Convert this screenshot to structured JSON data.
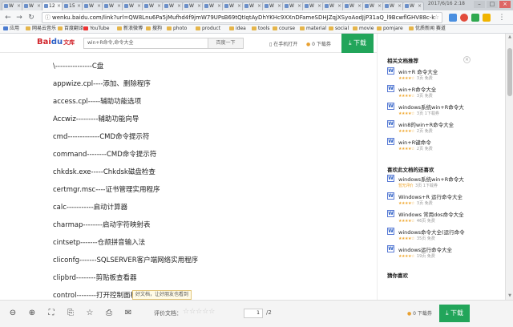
{
  "browser": {
    "tabs": [
      "W",
      "W",
      "12",
      "15",
      "W",
      "W",
      "W",
      "W",
      "W",
      "W",
      "W",
      "W",
      "W",
      "W",
      "W",
      "W",
      "W",
      "W",
      "W",
      "W",
      "W"
    ],
    "clock": "2017/6/16 2:18",
    "address": "wenku.baidu.com/link?url=QW8Lnu6Pa5jMufhd4f9jmW79UPsB69tQtIqtAyDhYKHc9XXnDFameSDHJZqjXSyoAodJjP31aQ_l9BcwflGHV88c-k",
    "bookmarks": [
      {
        "label": "应用",
        "icon": "apps-icon"
      },
      {
        "label": "网易云音乐",
        "icon": "folder-icon"
      },
      {
        "label": "百度翻译",
        "icon": "folder-icon"
      },
      {
        "label": "YouTube",
        "icon": "youtube-icon"
      },
      {
        "label": "新浪微博",
        "icon": "folder-icon"
      },
      {
        "label": "搜狗",
        "icon": "folder-icon"
      },
      {
        "label": "photo",
        "icon": "folder-icon"
      },
      {
        "label": "product",
        "icon": "folder-icon"
      },
      {
        "label": "idea",
        "icon": "folder-icon"
      },
      {
        "label": "tools",
        "icon": "folder-icon"
      },
      {
        "label": "course",
        "icon": "folder-icon"
      },
      {
        "label": "material",
        "icon": "folder-icon"
      },
      {
        "label": "social",
        "icon": "folder-icon"
      },
      {
        "label": "movie",
        "icon": "folder-icon"
      },
      {
        "label": "pomjare",
        "icon": "folder-icon"
      },
      {
        "label": "优质新闻 赛道",
        "icon": "folder-icon"
      }
    ]
  },
  "site": {
    "logo_bai": "Bai",
    "logo_du": "du",
    "logo_wk": "文库",
    "search_value": "win+R命令,命令大全",
    "search_button": "百度一下",
    "open_phone": "在手机打开",
    "coins": "0 下载券",
    "download": "下载"
  },
  "document": {
    "lines": [
      "\\---------------C盘",
      "appwize.cpl----添加、删除程序",
      "access.cpl-----辅助功能选项",
      "Accwiz---------辅助功能向导",
      "cmd-------------CMD命令提示符",
      "command--------CMD命令提示符",
      "chkdsk.exe-----Chkdsk磁盘检查",
      "certmgr.msc----证书管理实用程序",
      "calc-----------启动计算器",
      "charmap--------启动字符映射表",
      "cintsetp-------仓颉拼音输入法",
      "cliconfg-------SQLSERVER客户端网络实用程序",
      "clipbrd--------剪贴板查看器",
      "control--------打开控制面板"
    ]
  },
  "sidebar": {
    "related_title": "相关文档推荐",
    "related": [
      {
        "title": "win+R 命令大全",
        "meta_stars": "★★★★☆",
        "meta": "3页 免费"
      },
      {
        "title": "win+R命令大全",
        "meta_stars": "★★★★☆",
        "meta": "3页 免费"
      },
      {
        "title": "windows系统win+R命令大",
        "meta_stars": "★★★★☆",
        "meta": "3页 1下载券"
      },
      {
        "title": "win8的win+R命令大全",
        "meta_stars": "★★★★☆",
        "meta": "2页 免费"
      },
      {
        "title": "win+R键命令",
        "meta_stars": "★★★★☆",
        "meta": "2页 免费"
      }
    ],
    "liked_title": "喜欢此文档的还喜欢",
    "liked": [
      {
        "title": "windows系统win+R命令大",
        "meta_stars": "暂无评价",
        "meta": "3页 1下载券"
      },
      {
        "title": "Windows+R 运行命令大全",
        "meta_stars": "★★★★☆",
        "meta": "3页 免费"
      },
      {
        "title": "Windows 常用dos命令大全",
        "meta_stars": "★★★★☆",
        "meta": "46页 免费"
      },
      {
        "title": "windows命令大全(运行命令",
        "meta_stars": "★★★★☆",
        "meta": "35页 免费"
      },
      {
        "title": "windows运行命令大全",
        "meta_stars": "★★★★☆",
        "meta": "19页 免费"
      }
    ],
    "guess_title": "猜你喜欢"
  },
  "bottombar": {
    "tooltip": "好文档，让好朋友也看到",
    "rate_label": "评价文档：",
    "rate_stars": "☆☆☆☆☆",
    "page_current": "1",
    "page_total": "/2",
    "points": "0 下载券",
    "download": "下载"
  }
}
